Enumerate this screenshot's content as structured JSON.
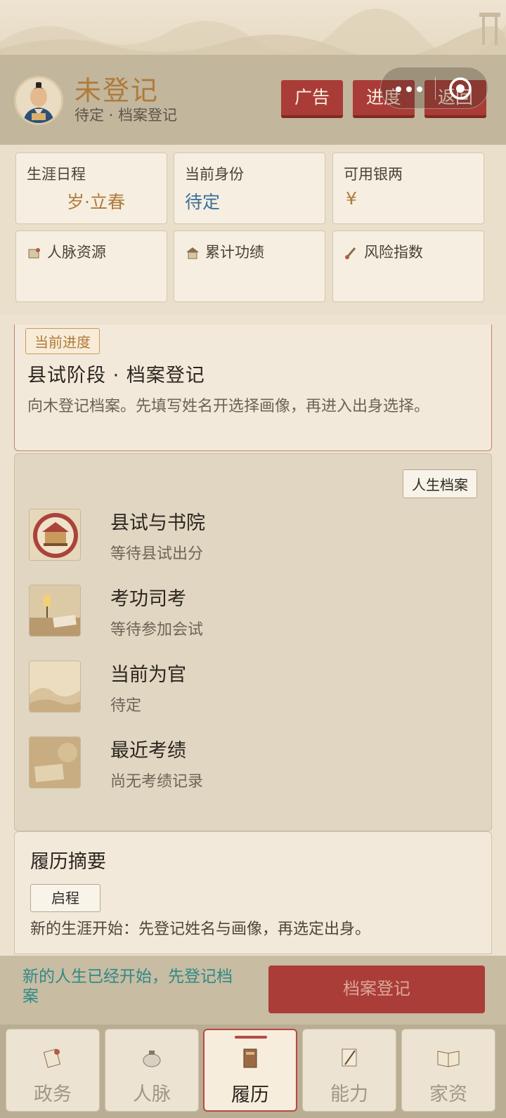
{
  "header": {
    "user_name": "未登记",
    "user_sub": "待定 · 档案登记",
    "btn_ad": "广告",
    "btn_progress": "进度",
    "btn_back": "返回"
  },
  "stats": [
    {
      "label": "生涯日程",
      "value": "岁·立春",
      "color": "#b07a3a"
    },
    {
      "label": "当前身份",
      "value": "待定",
      "color": "#3c6e9a"
    },
    {
      "label": "可用银两",
      "value": "¥",
      "color": "#b07a3a"
    },
    {
      "label": "人脉资源",
      "value": "",
      "icon": "scroll-icon"
    },
    {
      "label": "累计功绩",
      "value": "",
      "icon": "pavilion-icon"
    },
    {
      "label": "风险指数",
      "value": "",
      "icon": "brush-icon"
    }
  ],
  "progress": {
    "tag": "当前进度",
    "title": "县试阶段 · 档案登记",
    "desc": "向木登记档案。先填写姓名开选择画像，再进入出身选择。"
  },
  "archive": {
    "button": "人生档案",
    "records": [
      {
        "title": "县试与书院",
        "sub": "等待县试出分",
        "icon": "academy-seal-icon"
      },
      {
        "title": "考功司考",
        "sub": "等待参加会试",
        "icon": "lamp-desk-icon"
      },
      {
        "title": "当前为官",
        "sub": "待定",
        "icon": "landscape-scroll-icon"
      },
      {
        "title": "最近考绩",
        "sub": "尚无考绩记录",
        "icon": "old-book-icon"
      }
    ]
  },
  "summary": {
    "title": "履历摘要",
    "badge": "启程",
    "text": "新的生涯开始：先登记姓名与画像，再选定出身。"
  },
  "action": {
    "hint": "新的人生已经开始，先登记档案",
    "button": "档案登记"
  },
  "tabs": [
    {
      "label": "政务",
      "icon": "scroll-icon",
      "active": false
    },
    {
      "label": "人脉",
      "icon": "teapot-icon",
      "active": false
    },
    {
      "label": "履历",
      "icon": "book-icon",
      "active": true
    },
    {
      "label": "能力",
      "icon": "brush-paper-icon",
      "active": false
    },
    {
      "label": "家资",
      "icon": "open-book-icon",
      "active": false
    }
  ],
  "colors": {
    "accent_red": "#aa3d38",
    "gold": "#b07a3a",
    "teal": "#2f8a86"
  }
}
